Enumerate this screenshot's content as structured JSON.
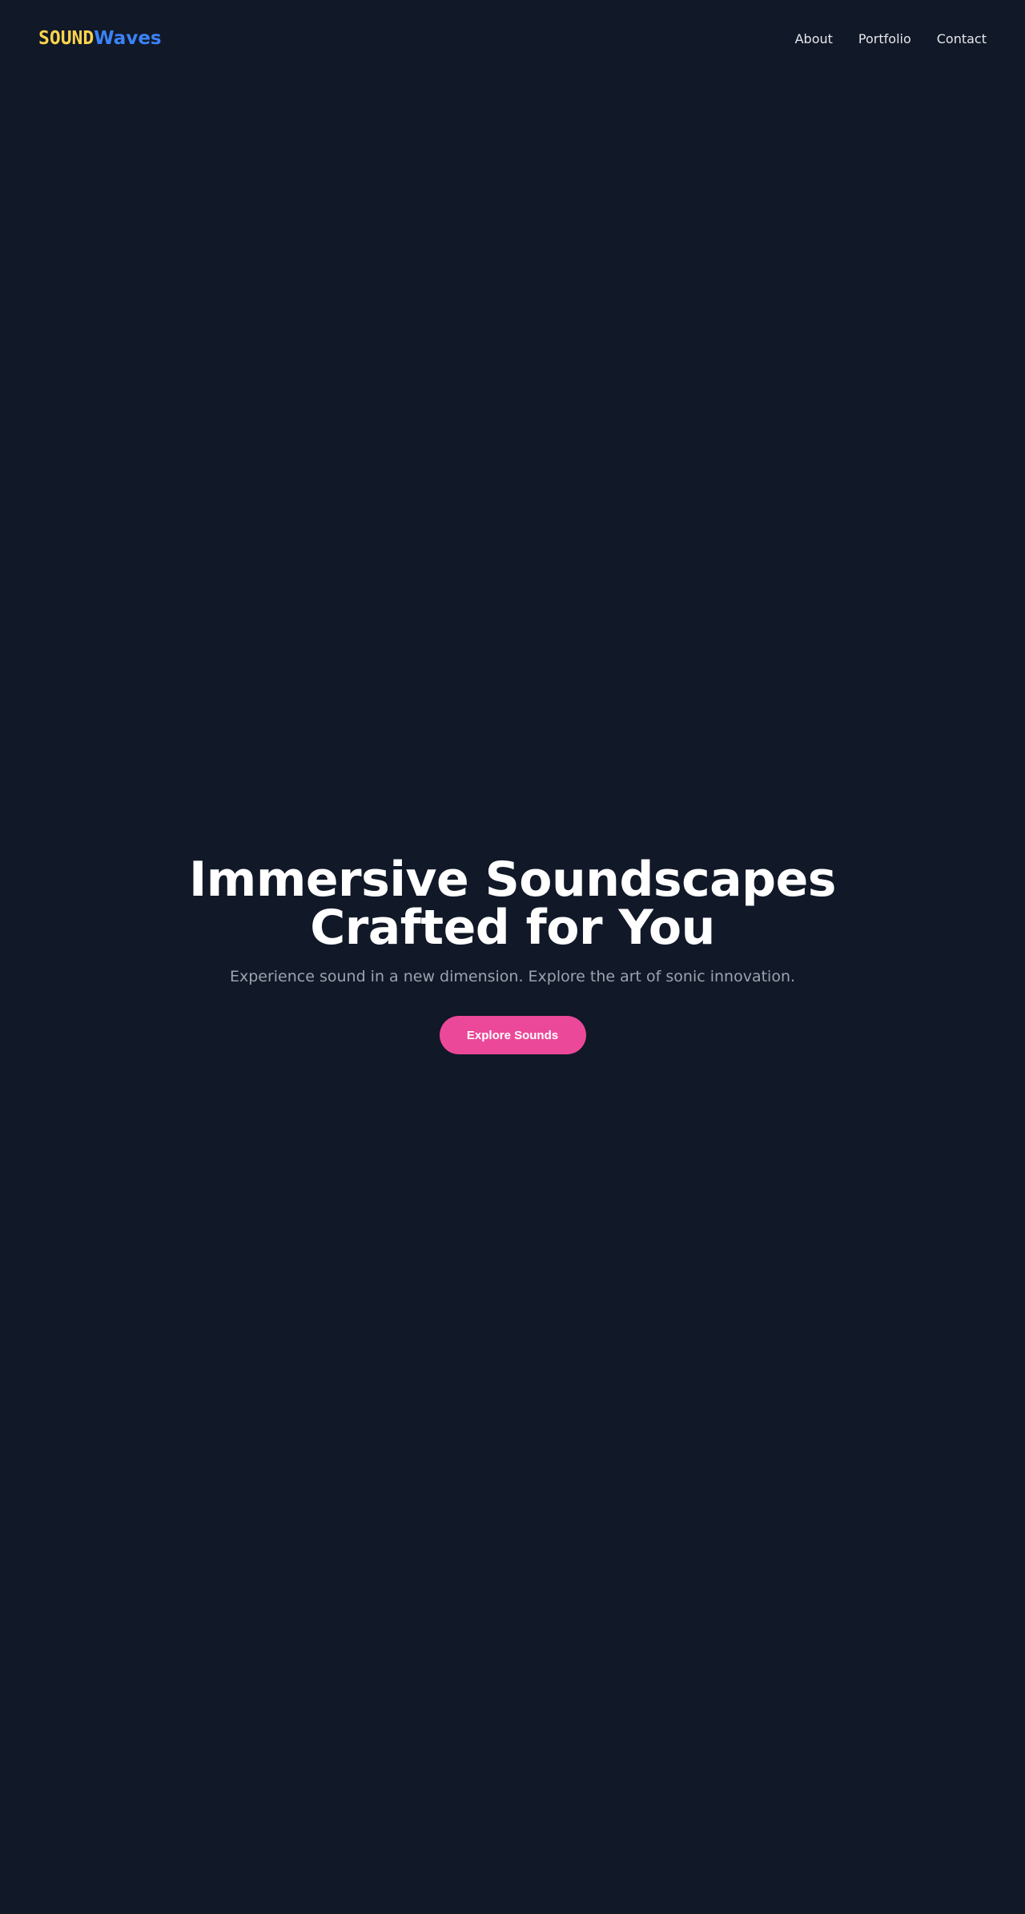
{
  "header": {
    "logo": {
      "part1": "SOUND",
      "part2": "Waves"
    },
    "nav": [
      {
        "label": "About"
      },
      {
        "label": "Portfolio"
      },
      {
        "label": "Contact"
      }
    ]
  },
  "hero": {
    "title_line1": "Immersive Soundscapes",
    "title_line2": "Crafted for You",
    "subtitle": "Experience sound in a new dimension. Explore the art of sonic innovation.",
    "cta_label": "Explore Sounds"
  },
  "colors": {
    "background": "#111827",
    "logo_primary": "#FCD34D",
    "logo_secondary": "#3B82F6",
    "accent": "#EC4899",
    "nav_text": "#E5E7EB",
    "subtitle_text": "#9CA3AF"
  }
}
